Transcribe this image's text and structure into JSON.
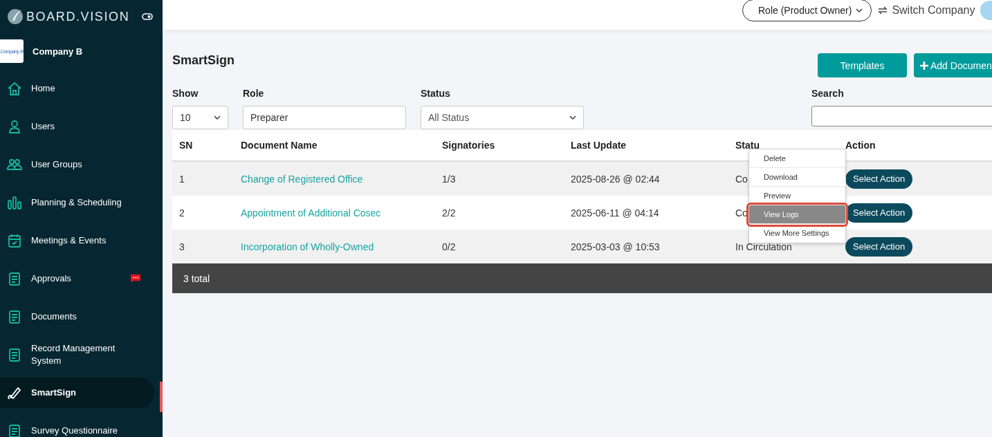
{
  "brand": "BOARD.VISION",
  "company": {
    "name": "Company B",
    "logo_text": "Company B"
  },
  "sidebar": {
    "items": [
      {
        "label": "Home",
        "selected": false,
        "notification": false
      },
      {
        "label": "Users",
        "selected": false,
        "notification": false
      },
      {
        "label": "User Groups",
        "selected": false,
        "notification": false
      },
      {
        "label": "Planning & Scheduling",
        "selected": false,
        "notification": false
      },
      {
        "label": "Meetings & Events",
        "selected": false,
        "notification": false
      },
      {
        "label": "Approvals",
        "selected": false,
        "notification": true
      },
      {
        "label": "Documents",
        "selected": false,
        "notification": false
      },
      {
        "label": "Record Management System",
        "selected": false,
        "notification": false
      },
      {
        "label": "SmartSign",
        "selected": true,
        "notification": false
      },
      {
        "label": "Survey Questionnaire",
        "selected": false,
        "notification": false
      }
    ]
  },
  "topbar": {
    "role": "Role (Product Owner)",
    "switch": "Switch Company"
  },
  "page": {
    "title": "SmartSign",
    "buttons": [
      "Templates",
      "Add Documen"
    ]
  },
  "filters": {
    "show_label": "Show",
    "show_value": "10",
    "role_label": "Role",
    "role_value": "Preparer",
    "status_label": "Status",
    "status_value": "All Status",
    "search_label": "Search"
  },
  "table": {
    "columns": [
      "SN",
      "Document Name",
      "Signatories",
      "Last Update",
      "Statu",
      "Action"
    ],
    "rows": [
      {
        "sn": "1",
        "name": "Change of Registered Office",
        "signatories": "1/3",
        "updated": "2025-08-26 @ 02:44",
        "status": "Co",
        "action": "Select Action"
      },
      {
        "sn": "2",
        "name": "Appointment of Additional Cosec",
        "signatories": "2/2",
        "updated": "2025-06-11 @ 04:14",
        "status": "Co",
        "action": "Select Action"
      },
      {
        "sn": "3",
        "name": "Incorporation of Wholly-Owned",
        "signatories": "0/2",
        "updated": "2025-03-03 @ 10:53",
        "status": "In Circulation",
        "action": "Select Action"
      }
    ],
    "footer": "3 total"
  },
  "menu": {
    "items": [
      {
        "label": "Delete",
        "selected": false
      },
      {
        "label": "Download",
        "selected": false
      },
      {
        "label": "Preview",
        "selected": false
      },
      {
        "label": "View Logs",
        "selected": true
      },
      {
        "label": "View More Settings",
        "selected": false
      }
    ]
  }
}
